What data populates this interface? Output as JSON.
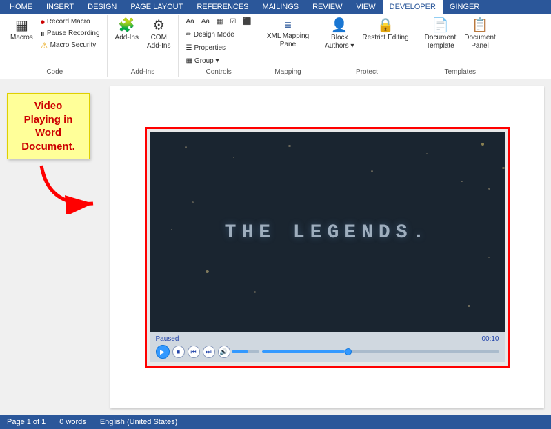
{
  "ribbon": {
    "tabs": [
      "HOME",
      "INSERT",
      "DESIGN",
      "PAGE LAYOUT",
      "REFERENCES",
      "MAILINGS",
      "REVIEW",
      "VIEW",
      "DEVELOPER",
      "GINGER"
    ],
    "active_tab": "DEVELOPER",
    "groups": [
      {
        "name": "Code",
        "items": [
          {
            "id": "macros",
            "label": "Macros",
            "icon": "▦"
          },
          {
            "id": "record-macro",
            "label": "Record Macro",
            "icon": "⏺",
            "small": true
          },
          {
            "id": "pause-recording",
            "label": "Pause Recording",
            "icon": "⏸",
            "small": true
          },
          {
            "id": "macro-security",
            "label": "Macro Security",
            "icon": "⚠",
            "small": true
          }
        ]
      },
      {
        "name": "Add-Ins",
        "items": [
          {
            "id": "add-ins",
            "label": "Add-Ins",
            "icon": "🧩"
          },
          {
            "id": "com-add-ins",
            "label": "COM Add-Ins",
            "icon": "⚙"
          }
        ]
      },
      {
        "name": "Controls",
        "items": [
          {
            "id": "design-mode",
            "label": "Design Mode",
            "icon": "✏"
          },
          {
            "id": "properties",
            "label": "Properties",
            "icon": "☰"
          },
          {
            "id": "group",
            "label": "Group ▾",
            "icon": "▦"
          }
        ]
      },
      {
        "name": "Mapping",
        "items": [
          {
            "id": "xml-mapping",
            "label": "XML Mapping Pane",
            "icon": "≡"
          }
        ]
      },
      {
        "name": "Protect",
        "items": [
          {
            "id": "block-authors",
            "label": "Block Authors",
            "icon": "👤"
          },
          {
            "id": "restrict-editing",
            "label": "Restrict Editing",
            "icon": "🔒"
          }
        ]
      },
      {
        "name": "Templates",
        "items": [
          {
            "id": "document-template",
            "label": "Document Template",
            "icon": "📄"
          },
          {
            "id": "document-panel",
            "label": "Document Panel",
            "icon": "📋"
          }
        ]
      }
    ]
  },
  "annotation": {
    "sticky_text": "Video Playing in Word Document.",
    "arrow_label": "arrow pointing right"
  },
  "video": {
    "title": "THE LEGENDS.",
    "status_left": "Paused",
    "status_right": "00:10",
    "controls": {
      "play_label": "▶",
      "stop_label": "■",
      "prev_label": "⏮",
      "next_label": "⏭",
      "volume_label": "🔊"
    }
  },
  "status_bar": {
    "page_info": "Page 1 of 1",
    "words": "0 words",
    "language": "English (United States)"
  }
}
